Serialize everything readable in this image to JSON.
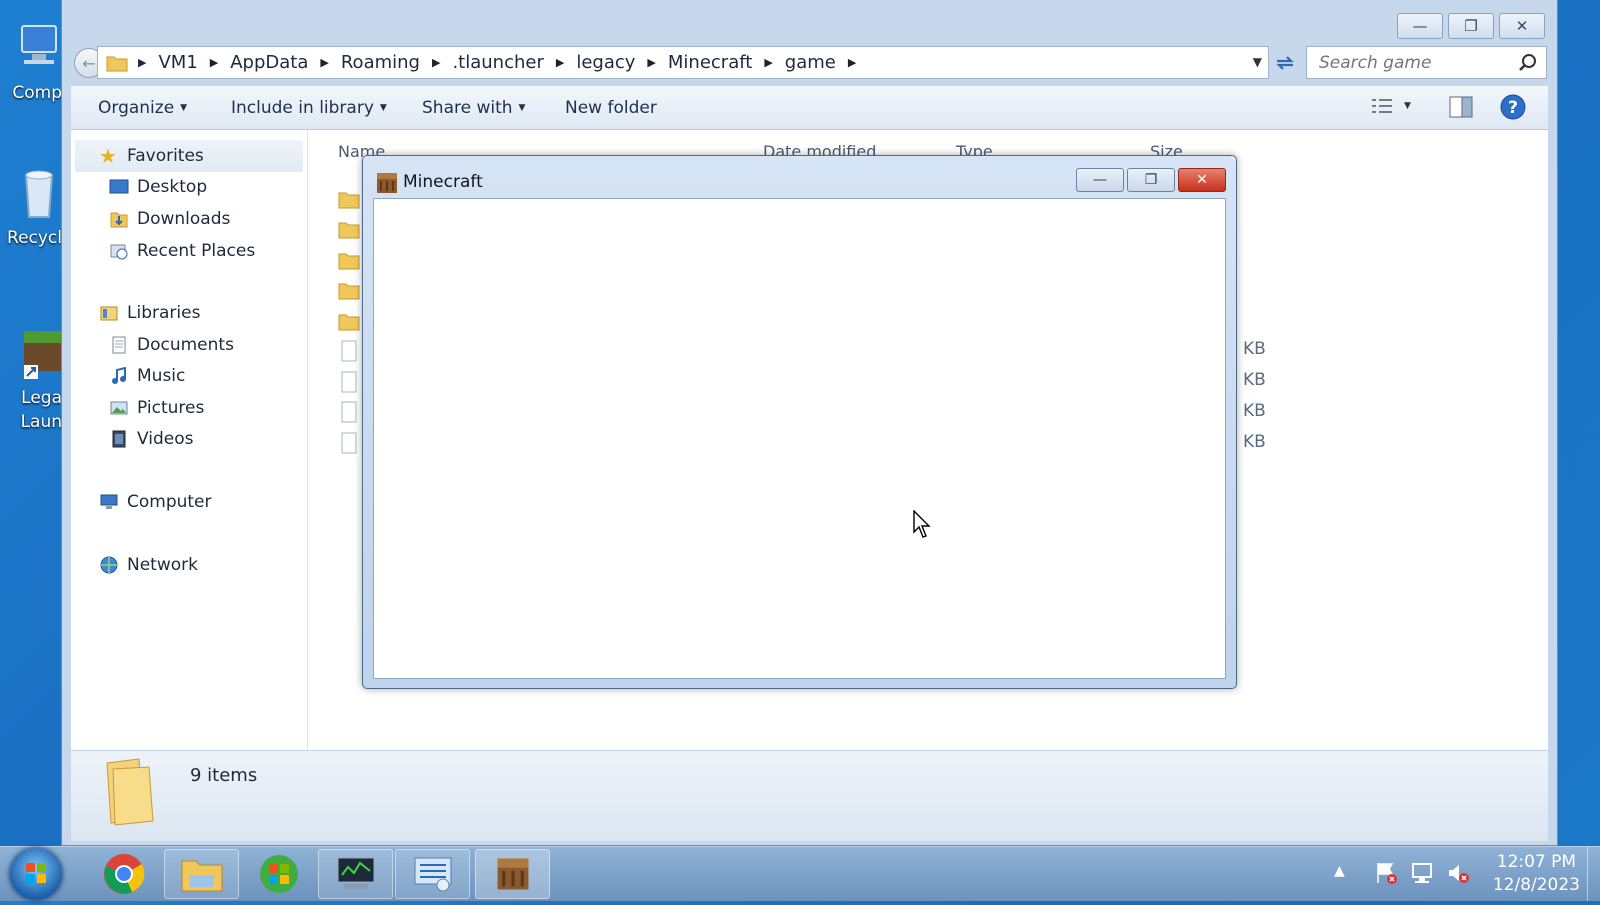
{
  "desktop": {
    "icons": [
      {
        "label": "Comp"
      },
      {
        "label": "Recycl"
      },
      {
        "label": "Lega",
        "label2": "Laun"
      }
    ]
  },
  "explorer": {
    "breadcrumb": [
      "VM1",
      "AppData",
      "Roaming",
      ".tlauncher",
      "legacy",
      "Minecraft",
      "game"
    ],
    "search_placeholder": "Search game",
    "toolbar": {
      "organize": "Organize",
      "include_in_library": "Include in library",
      "share_with": "Share with",
      "new_folder": "New folder"
    },
    "nav": {
      "favorites": "Favorites",
      "desktop": "Desktop",
      "downloads": "Downloads",
      "recent_places": "Recent Places",
      "libraries": "Libraries",
      "documents": "Documents",
      "music": "Music",
      "pictures": "Pictures",
      "videos": "Videos",
      "computer": "Computer",
      "network": "Network"
    },
    "columns": {
      "name": "Name",
      "date_modified": "Date modified",
      "type": "Type",
      "size": "Size"
    },
    "file_sizes": [
      "KB",
      "KB",
      "KB",
      "KB"
    ],
    "status": {
      "item_count": "9 items"
    }
  },
  "minecraft_window": {
    "title": "Minecraft"
  },
  "taskbar": {
    "time": "12:07 PM",
    "date": "12/8/2023"
  }
}
